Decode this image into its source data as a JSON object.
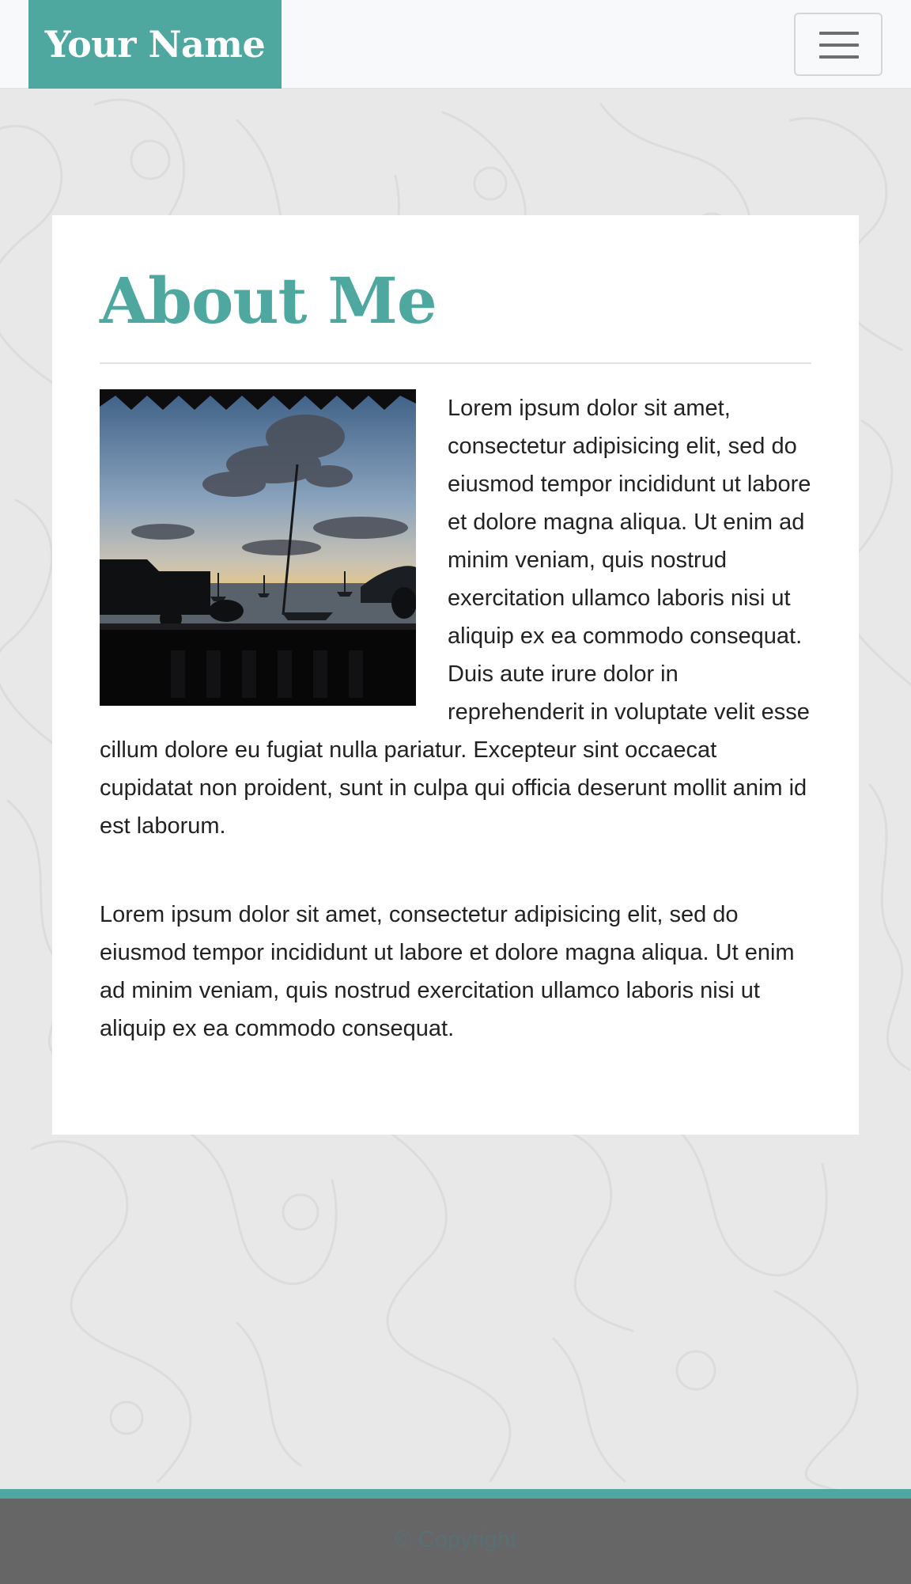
{
  "navbar": {
    "brand": "Your Name",
    "menu_icon": "hamburger-menu-icon"
  },
  "about": {
    "title": "About Me",
    "photo_alt": "Sunset over a harbor with sailboats",
    "paragraphs": [
      "Lorem ipsum dolor sit amet, consectetur adipisicing elit, sed do eiusmod tempor incididunt ut labore et dolore magna aliqua. Ut enim ad minim veniam, quis nostrud exercitation ullamco laboris nisi ut aliquip ex ea commodo consequat. Duis aute irure dolor in reprehenderit in voluptate velit esse cillum dolore eu fugiat nulla pariatur. Excepteur sint occaecat cupidatat non proident, sunt in culpa qui officia deserunt mollit anim id est laborum.",
      "Lorem ipsum dolor sit amet, consectetur adipisicing elit, sed do eiusmod tempor incididunt ut labore et dolore magna aliqua. Ut enim ad minim veniam, quis nostrud exercitation ullamco laboris nisi ut aliquip ex ea commodo consequat."
    ]
  },
  "footer": {
    "copyright": "© Copyright"
  },
  "colors": {
    "accent": "#4fa8a0",
    "navbar_bg": "#f8f9fa",
    "page_bg": "#e8e8e8",
    "footer_bg": "#666666",
    "text": "#222222"
  }
}
